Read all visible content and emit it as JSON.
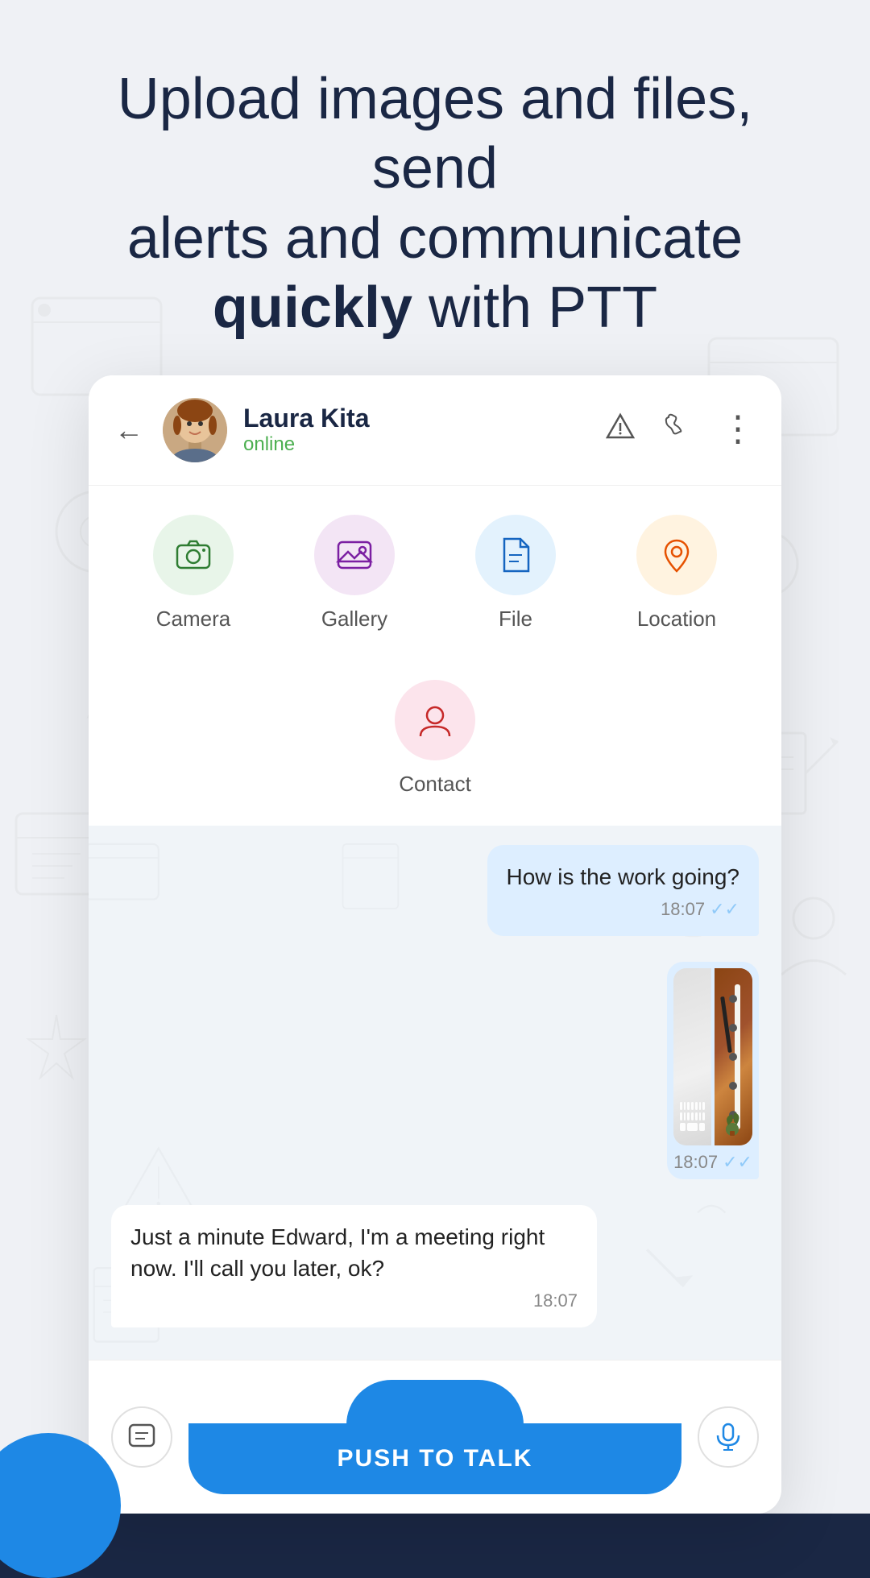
{
  "hero": {
    "title_line1": "Upload images and files, send",
    "title_line2": "alerts and communicate",
    "title_line3_normal": "with PTT",
    "title_line3_bold": "quickly"
  },
  "chat": {
    "back_label": "←",
    "contact_name": "Laura Kita",
    "contact_status": "online",
    "header_icons": {
      "alert": "⚠",
      "call": "📞",
      "more": "⋮"
    },
    "attach_menu": {
      "items": [
        {
          "label": "Camera",
          "icon": "📷",
          "color": "green"
        },
        {
          "label": "Gallery",
          "icon": "🖼",
          "color": "purple"
        },
        {
          "label": "File",
          "icon": "📄",
          "color": "blue"
        },
        {
          "label": "Location",
          "icon": "📍",
          "color": "orange"
        },
        {
          "label": "Contact",
          "icon": "👤",
          "color": "pink"
        }
      ]
    },
    "messages": [
      {
        "text": "How is the work going?",
        "time": "18:07",
        "type": "received",
        "has_check": true
      },
      {
        "text": "",
        "time": "18:07",
        "type": "received",
        "has_images": true,
        "has_check": true
      },
      {
        "text": "Just a minute Edward, I'm a meeting right now. I'll call you later, ok?",
        "time": "18:07",
        "type": "sent"
      }
    ],
    "ptt_button_label": "PUSH TO TALK"
  }
}
